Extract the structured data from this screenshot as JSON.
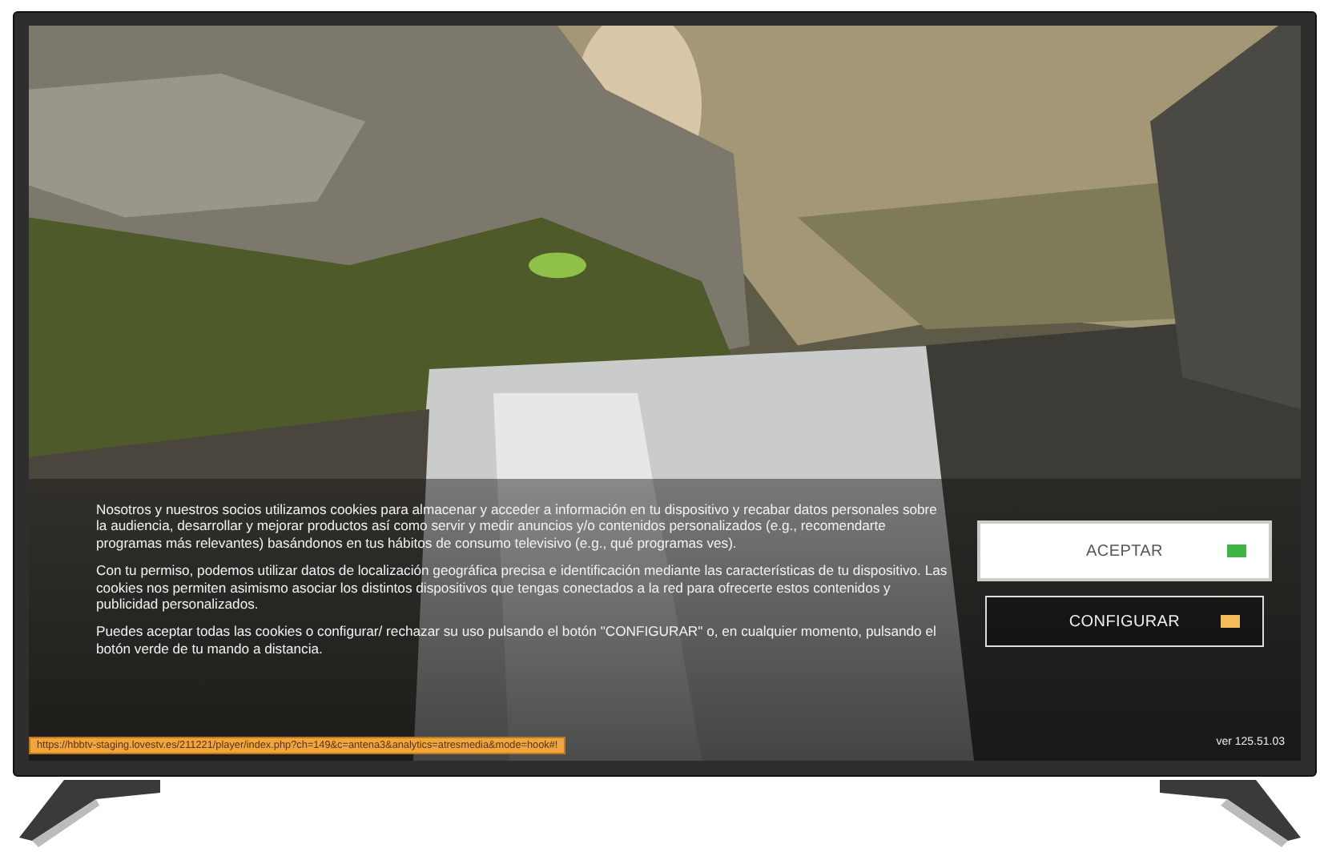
{
  "consent": {
    "paragraphs": [
      "Nosotros y nuestros socios utilizamos cookies para almacenar y acceder a información en tu dispositivo y recabar datos personales sobre la audiencia, desarrollar y mejorar productos así como servir y medir anuncios y/o contenidos personalizados (e.g., recomendarte programas más relevantes) basándonos en tus hábitos de consumo televisivo (e.g., qué programas ves).",
      "Con tu permiso, podemos utilizar datos de localización geográfica precisa e identificación mediante las características de tu dispositivo. Las cookies nos permiten asimismo asociar los distintos dispositivos que tengas conectados a la red para ofrecerte estos contenidos y publicidad personalizados.",
      "Puedes aceptar todas las cookies o configurar/ rechazar su uso pulsando el botón \"CONFIGURAR\" o, en cualquier momento, pulsando el botón verde de tu mando a distancia."
    ],
    "buttons": [
      {
        "label": "ACEPTAR",
        "selected": true,
        "color": "#3fb449"
      },
      {
        "label": "CONFIGURAR",
        "selected": false,
        "color": "#f4bb5a"
      }
    ]
  },
  "status_url": "https://hbbtv-staging.lovestv.es/211221/player/index.php?ch=149&c=antena3&analytics=atresmedia&mode=hook#!",
  "version": "ver 125.51.03"
}
